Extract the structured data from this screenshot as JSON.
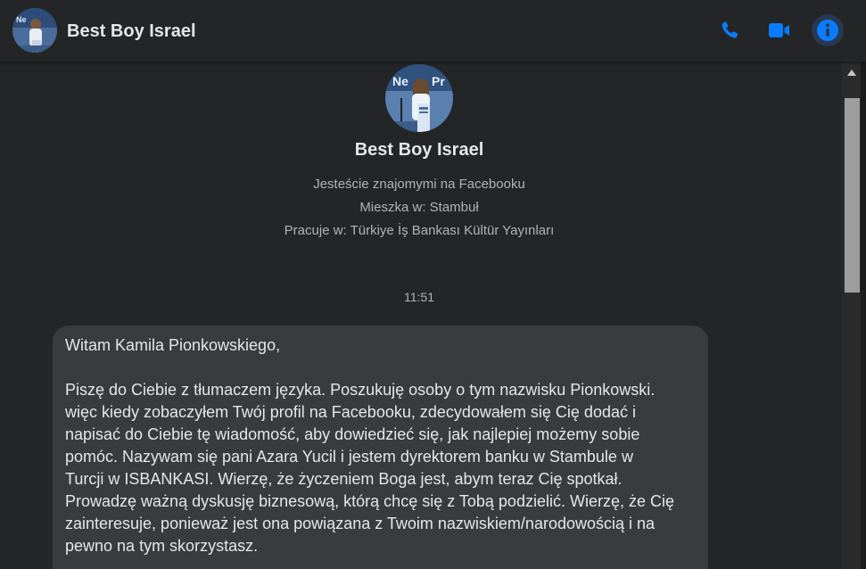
{
  "header": {
    "contact_name": "Best Boy Israel",
    "phone_icon": "phone-icon",
    "video_icon": "video-camera-icon",
    "info_icon": "info-icon",
    "accent_color": "#0a7cff"
  },
  "profile": {
    "name": "Best Boy Israel",
    "friends_line": "Jesteście znajomymi na Facebooku",
    "lives_line": "Mieszka w: Stambuł",
    "works_line": "Pracuje w: Türkiye İş Bankası Kültür Yayınları"
  },
  "conversation": {
    "timestamp": "11:51",
    "messages": [
      {
        "text": "Witam Kamila Pionkowskiego,\n\nPiszę do Ciebie z tłumaczem języka. Poszukuję osoby o tym nazwisku Pionkowski.\nwięc kiedy zobaczyłem Twój profil na Facebooku, zdecydowałem się Cię dodać i\nnapisać do Ciebie tę wiadomość, aby dowiedzieć się, jak najlepiej możemy sobie\npomóc. Nazywam się pani Azara Yucil i jestem dyrektorem banku w Stambule w\nTurcji w ISBANKASI. Wierzę, że życzeniem Boga jest, abym teraz Cię spotkał.\nProwadzę ważną dyskusję biznesową, którą chcę się z Tobą podzielić. Wierzę, że Cię\nzainteresuje, ponieważ jest ona powiązana z Twoim nazwiskiem/narodowością i na\npewno na tym skorzystasz."
      }
    ]
  }
}
